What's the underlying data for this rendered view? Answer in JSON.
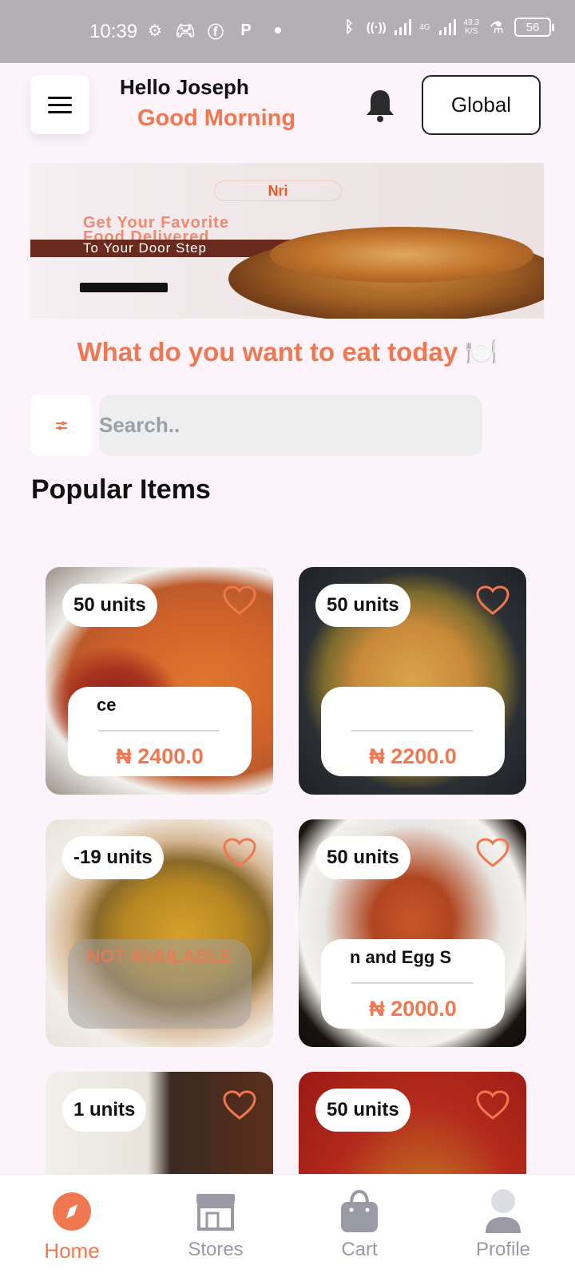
{
  "status_bar": {
    "time": "10:39",
    "network": "4G",
    "speed_value": "49.3",
    "speed_unit": "K/S",
    "battery": "56"
  },
  "header": {
    "hello": "Hello Joseph",
    "greeting": "Good Morning",
    "region_button": "Global"
  },
  "banner": {
    "brand": "Nri",
    "headline_line1": "Get Your Favorite",
    "headline_line2": "Food Delivered",
    "headline_line3": "To Your Door Step"
  },
  "prompt": "What do you want to eat today 🍽️",
  "search": {
    "placeholder": "Search.."
  },
  "popular": {
    "title": "Popular Items",
    "items": [
      {
        "units": "50 units",
        "name": "ce",
        "price": "₦ 2400.0",
        "available": true,
        "bg": "jollof"
      },
      {
        "units": "50 units",
        "name": "",
        "price": "₦ 2200.0",
        "available": true,
        "bg": "noodles"
      },
      {
        "units": "-19 units",
        "name": "NOT AVAILABLE",
        "price": "",
        "available": false,
        "bg": "egusi"
      },
      {
        "units": "50 units",
        "name": "n and Egg S",
        "price": "₦ 2000.0",
        "available": true,
        "bg": "plantain"
      },
      {
        "units": "1 units",
        "name": "",
        "price": "",
        "available": true,
        "bg": "rice"
      },
      {
        "units": "50 units",
        "name": "",
        "price": "",
        "available": true,
        "bg": "chicken"
      }
    ]
  },
  "nav": {
    "home": "Home",
    "stores": "Stores",
    "cart": "Cart",
    "profile": "Profile"
  },
  "colors": {
    "accent": "#f07850",
    "background": "#fcf3fb",
    "status_bar": "#b3afb5",
    "inactive": "#9a9aa6"
  }
}
